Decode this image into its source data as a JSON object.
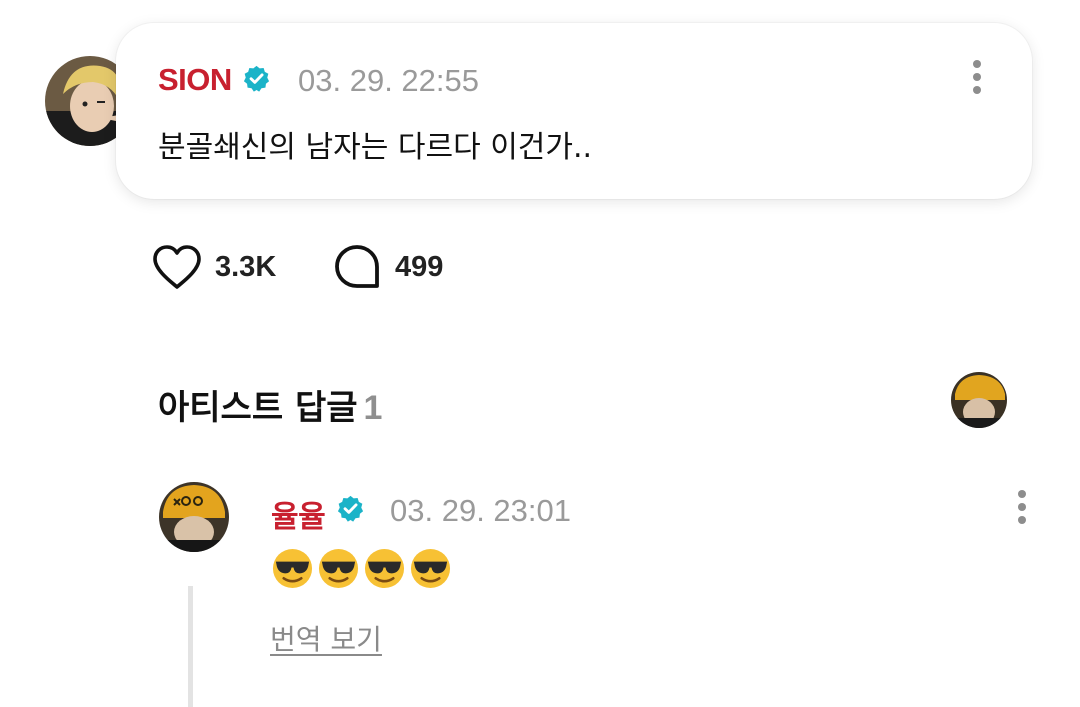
{
  "post": {
    "author": "SION",
    "timestamp": "03. 29. 22:55",
    "text": "분골쇄신의 남자는 다르다 이건가..",
    "likes": "3.3K",
    "comments": "499"
  },
  "artist_replies": {
    "title": "아티스트 답글",
    "count": "1"
  },
  "reply": {
    "author": "율율",
    "timestamp": "03. 29. 23:01",
    "emoji_names": [
      "smiling-face-with-sunglasses",
      "smiling-face-with-sunglasses",
      "smiling-face-with-sunglasses",
      "smiling-face-with-sunglasses"
    ],
    "translate_label": "번역 보기"
  },
  "colors": {
    "author_name": "#c8202f",
    "verified": "#1bb3c8",
    "muted": "#9a9a9a"
  }
}
